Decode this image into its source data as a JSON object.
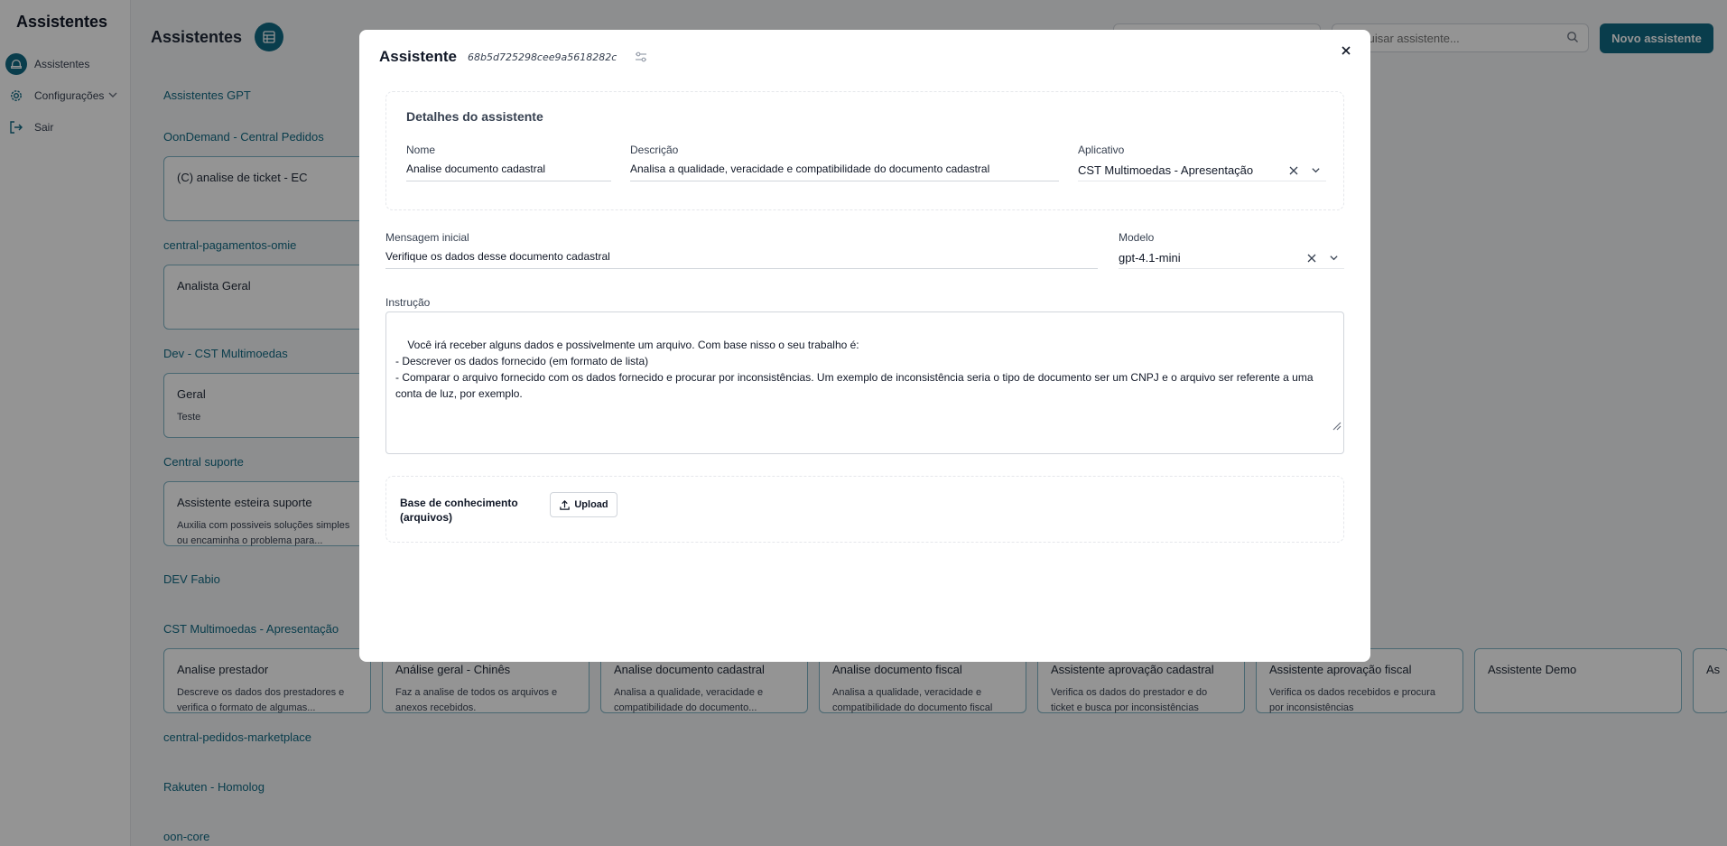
{
  "sidebar": {
    "brand": "Assistentes",
    "items": [
      {
        "label": "Assistentes",
        "icon": "hat-icon",
        "active": true
      },
      {
        "label": "Configurações",
        "icon": "gear-icon"
      },
      {
        "label": "Sair",
        "icon": "logout-icon"
      }
    ]
  },
  "page": {
    "title": "Assistentes",
    "search_placeholder": "Pesquisar assistente...",
    "new_button": "Novo assistente"
  },
  "groups": [
    {
      "title": "Assistentes GPT",
      "cards": []
    },
    {
      "title": "OonDemand - Central Pedidos",
      "cards": [
        {
          "name": "(C) analise de ticket - EC",
          "desc": ""
        }
      ]
    },
    {
      "title": "central-pagamentos-omie",
      "cards": [
        {
          "name": "Analista Geral",
          "desc": ""
        }
      ]
    },
    {
      "title": "Dev - CST Multimoedas",
      "cards": [
        {
          "name": "Geral",
          "desc": "Teste"
        }
      ]
    },
    {
      "title": "Central suporte",
      "cards": [
        {
          "name": "Assistente esteira suporte",
          "desc": "Auxilia com possiveis soluções simples ou encaminha o problema para..."
        }
      ]
    },
    {
      "title": "DEV Fabio",
      "cards": []
    },
    {
      "title": "CST Multimoedas - Apresentação",
      "cards": [
        {
          "name": "Analise prestador",
          "desc": "Descreve os dados dos prestadores e verifica o formato de algumas..."
        },
        {
          "name": "Análise geral - Chinês",
          "desc": "Faz a analise de todos os arquivos e anexos recebidos."
        },
        {
          "name": "Analise documento cadastral",
          "desc": "Analisa a qualidade, veracidade e compatibilidade do documento..."
        },
        {
          "name": "Analise documento fiscal",
          "desc": "Analisa a qualidade, veracidade e compatibilidade do documento fiscal"
        },
        {
          "name": "Assistente aprovação cadastral",
          "desc": "Verifica os dados do prestador e do ticket e busca por inconsistências"
        },
        {
          "name": "Assistente aprovação fiscal",
          "desc": "Verifica os dados recebidos e procura por inconsistências"
        },
        {
          "name": "Assistente Demo",
          "desc": ""
        },
        {
          "name": "As",
          "desc": ""
        }
      ]
    },
    {
      "title": "central-pedidos-marketplace",
      "cards": []
    },
    {
      "title": "Rakuten - Homolog",
      "cards": []
    },
    {
      "title": "oon-core",
      "cards": []
    }
  ],
  "modal": {
    "title": "Assistente",
    "id": "68b5d725298cee9a5618282c",
    "details_title": "Detalhes do assistente",
    "name_label": "Nome",
    "name_value": "Analise documento cadastral",
    "desc_label": "Descrição",
    "desc_value": "Analisa a qualidade, veracidade e compatibilidade do documento cadastral",
    "app_label": "Aplicativo",
    "app_value": "CST Multimoedas - Apresentação",
    "msg_label": "Mensagem inicial",
    "msg_value": "Verifique os dados desse documento cadastral",
    "model_label": "Modelo",
    "model_value": "gpt-4.1-mini",
    "instr_label": "Instrução",
    "instr_value": "Você irá receber alguns dados e possivelmente um arquivo. Com base nisso o seu trabalho é:\n- Descrever os dados fornecido (em formato de lista)\n- Comparar o arquivo fornecido com os dados fornecido e procurar por inconsistências. Um exemplo de inconsistência seria o tipo de documento ser um CNPJ e o arquivo ser referente a uma conta de luz, por exemplo.",
    "kb_label": "Base de conhecimento (arquivos)",
    "upload_label": "Upload"
  }
}
